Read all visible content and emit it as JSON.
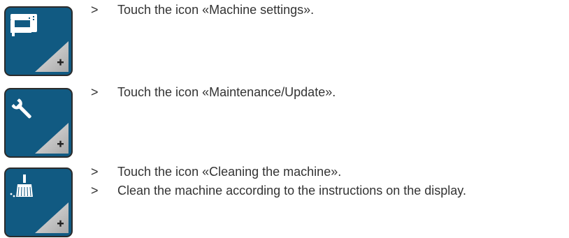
{
  "steps": [
    {
      "icon": "sewing-machine-icon",
      "tile_action": "+",
      "instructions": [
        {
          "marker": ">",
          "text": "Touch the icon «Machine settings»."
        }
      ]
    },
    {
      "icon": "wrench-icon",
      "tile_action": "+",
      "instructions": [
        {
          "marker": ">",
          "text": "Touch the icon «Maintenance/Update»."
        }
      ]
    },
    {
      "icon": "broom-icon",
      "tile_action": "+",
      "instructions": [
        {
          "marker": ">",
          "text": "Touch the icon «Cleaning the machine»."
        },
        {
          "marker": ">",
          "text": "Clean the machine according to the instructions on the display."
        }
      ]
    }
  ],
  "colors": {
    "tile_bg": "#115a82",
    "tile_border": "#2b2b2b",
    "corner_gray": "#c8c8c8",
    "text": "#333333"
  }
}
